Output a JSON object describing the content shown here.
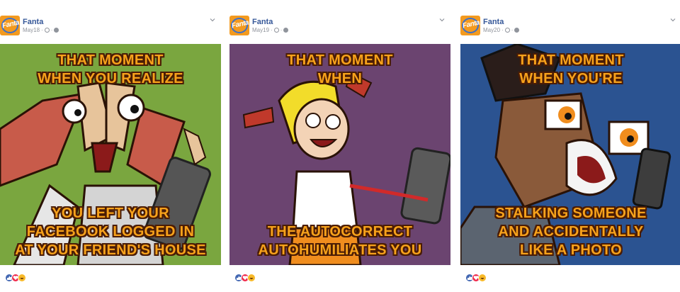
{
  "posts": [
    {
      "page_name": "Fanta",
      "date": "May18",
      "logo_text": "Fanta",
      "background": "#7aa63f",
      "caption_top": [
        "THAT MOMENT",
        "WHEN YOU REALIZE"
      ],
      "caption_bottom": [
        "YOU LEFT YOUR",
        "FACEBOOK LOGGED IN",
        "AT YOUR FRIEND'S HOUSE"
      ],
      "reactions": [
        "like-icon",
        "love-icon",
        "haha-icon"
      ]
    },
    {
      "page_name": "Fanta",
      "date": "May19",
      "logo_text": "Fanta",
      "background": "#6b4470",
      "caption_top": [
        "THAT MOMENT",
        "WHEN"
      ],
      "caption_bottom": [
        "THE AUTOCORRECT",
        "AUTOHUMILIATES YOU"
      ],
      "reactions": [
        "like-icon",
        "love-icon",
        "haha-icon"
      ]
    },
    {
      "page_name": "Fanta",
      "date": "May20",
      "logo_text": "Fanta",
      "background": "#2b5391",
      "caption_top": [
        "THAT MOMENT",
        "WHEN YOU'RE"
      ],
      "caption_bottom": [
        "STALKING SOMEONE",
        "AND ACCIDENTALLY",
        "LIKE A PHOTO"
      ],
      "reactions": [
        "like-icon",
        "love-icon",
        "haha-icon"
      ]
    }
  ],
  "colors": {
    "brand_orange": "#f39a1f",
    "caption_fill": "#f7a21b",
    "caption_outline": "#4a1c05",
    "link_blue": "#365899"
  }
}
